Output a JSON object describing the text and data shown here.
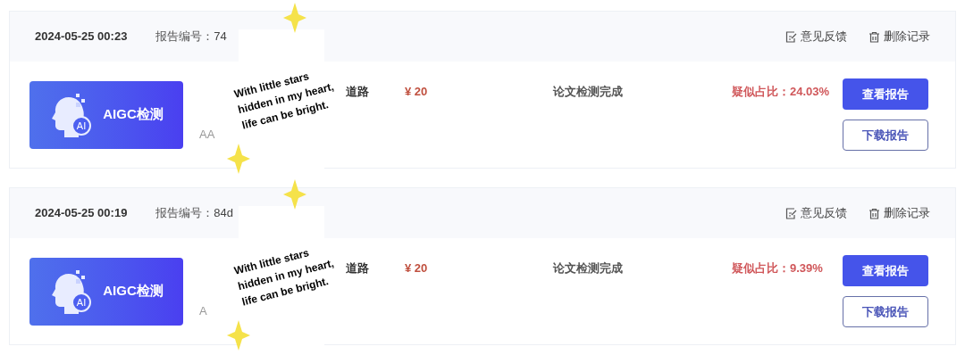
{
  "records": [
    {
      "time": "2024-05-25 00:23",
      "report_no_label": "报告编号：",
      "report_no": "74",
      "product": "AIGC检测",
      "badge": "AI",
      "title": "道路",
      "author": "AA",
      "price": "¥ 20",
      "status": "论文检测完成",
      "ratio": "疑似占比：24.03%",
      "feedback": "意见反馈",
      "delete": "删除记录",
      "view": "查看报告",
      "download": "下载报告",
      "sticker": [
        "With little stars",
        "hidden in my heart,",
        "life can be bright."
      ]
    },
    {
      "time": "2024-05-25 00:19",
      "report_no_label": "报告编号：",
      "report_no": "84d",
      "product": "AIGC检测",
      "badge": "AI",
      "title": "道路",
      "author": "A",
      "price": "¥ 20",
      "status": "论文检测完成",
      "ratio": "疑似占比：9.39%",
      "feedback": "意见反馈",
      "delete": "删除记录",
      "view": "查看报告",
      "download": "下载报告",
      "sticker": [
        "With little stars",
        "hidden in my heart,",
        "life can be bright."
      ]
    }
  ]
}
